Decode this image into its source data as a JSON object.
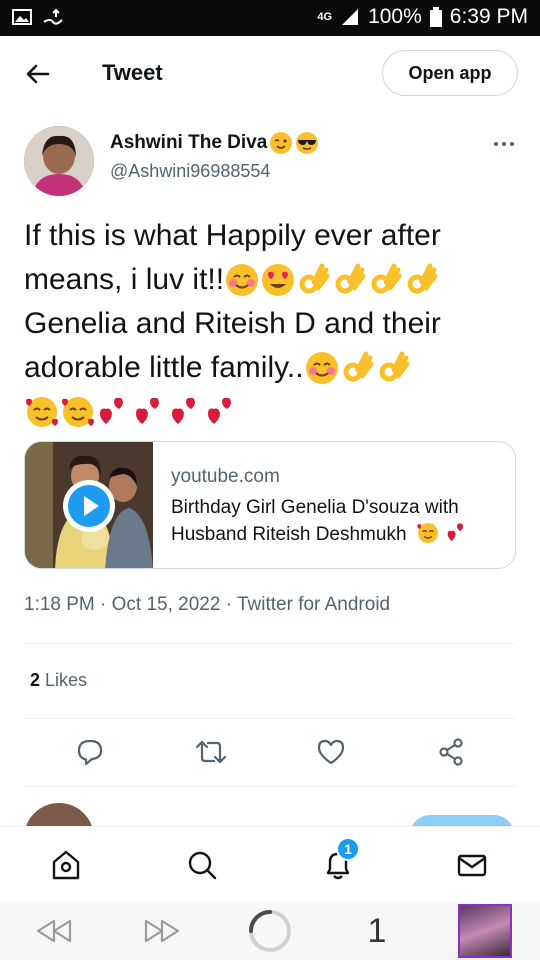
{
  "status_bar": {
    "network": "4G",
    "battery": "100%",
    "time": "6:39 PM"
  },
  "header": {
    "title": "Tweet",
    "open_app_label": "Open app"
  },
  "tweet": {
    "author_name": "Ashwini The Diva",
    "author_handle": "@Ashwini96988554",
    "text_line1": "If this is what Happily ever after",
    "text_line2": "means, i luv it!!",
    "text_line3": "Genelia and Riteish D and their",
    "text_line4": "adorable little family..",
    "card": {
      "domain": "youtube.com",
      "title": "Birthday Girl Genelia D'souza with Husband Riteish Deshmukh"
    },
    "meta": "1:18 PM · Oct 15, 2022 · Twitter for Android",
    "likes_count": "2",
    "likes_label": "Likes"
  },
  "bottom_nav": {
    "notifications_badge": "1"
  },
  "browser": {
    "tab_count": "1"
  },
  "colors": {
    "accent": "#1d9bf0",
    "text_primary": "#0f1419",
    "text_secondary": "#536471",
    "border": "#cfd9de",
    "emoji_yellow": "#f9c02b",
    "emoji_heart": "#d81b3a"
  },
  "icons": [
    "back-arrow-icon",
    "more-icon",
    "play-icon",
    "reply-icon",
    "retweet-icon",
    "like-icon",
    "share-icon",
    "home-icon",
    "search-icon",
    "notifications-icon",
    "messages-icon",
    "browser-back-icon",
    "browser-forward-icon",
    "reload-icon"
  ]
}
